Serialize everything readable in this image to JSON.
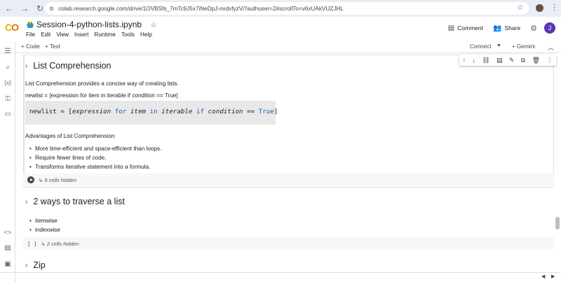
{
  "browser": {
    "url": "colab.research.google.com/drive/1OVBSfs_7mTc9J5x7iNeDpJ-nvdvfyzVi?authuser=2#scrollTo=v6xUAkVUZJHL"
  },
  "header": {
    "logo_text": "CO",
    "notebook_title": "Session-4-python-lists.ipynb",
    "menu": [
      "File",
      "Edit",
      "View",
      "Insert",
      "Runtime",
      "Tools",
      "Help"
    ],
    "comment_label": "Comment",
    "share_label": "Share",
    "user_initial": "J"
  },
  "toolbar": {
    "add_code": "+ Code",
    "add_text": "+ Text",
    "connect": "Connect",
    "gemini": "+ Gemini"
  },
  "sections": {
    "list_comprehension": {
      "heading": "List Comprehension",
      "intro": "List Comprehension provides a concise way of creating lists.",
      "syntax_line": "newlist = [expression for item in iterable if condition == True]",
      "code": {
        "p1": "newlist = [",
        "p2": "expression",
        "p3": "for",
        "p4": "item",
        "p5": "in",
        "p6": "iterable",
        "p7": "if",
        "p8": "condition",
        "p9": "==",
        "p10": "True",
        "p11": "]"
      },
      "advantages_title": "Advantages of List Comprehension",
      "advantages": [
        "More time-efficient and space-efficient than loops.",
        "Require fewer lines of code.",
        "Transforms iterative statement into a formula."
      ],
      "hidden_cells": "↳ 9 cells hidden"
    },
    "traverse": {
      "heading": "2 ways to traverse a list",
      "items": [
        "itemwise",
        "indexwise"
      ],
      "hidden_cells": "↳ 2 cells hidden",
      "bracket": "[ ]"
    },
    "zip": {
      "heading": "Zip"
    }
  },
  "colors": {
    "keyword": "#1a5cc2",
    "logo_orange": "#f9ab00",
    "avatar_purple": "#5e35b1"
  }
}
